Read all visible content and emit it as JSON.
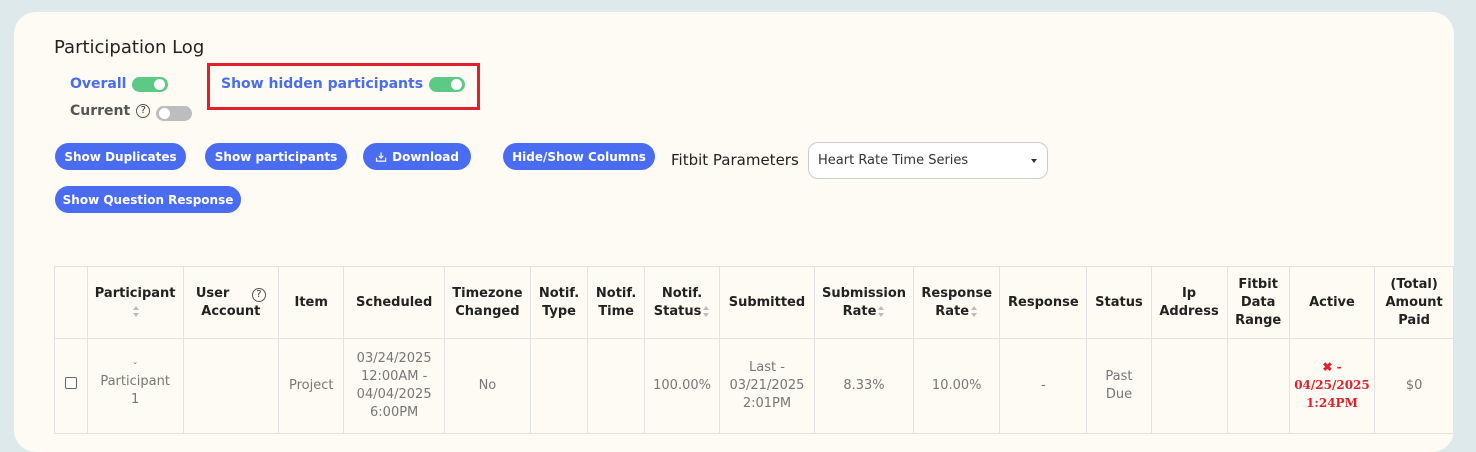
{
  "page_title": "Participation Log",
  "toggles": {
    "overall_label": "Overall",
    "overall_on": true,
    "current_label": "Current",
    "current_help": "?",
    "current_on": false,
    "hidden_label": "Show hidden participants",
    "hidden_on": true
  },
  "buttons": {
    "show_duplicates": "Show Duplicates",
    "show_participants": "Show participants",
    "download": "Download",
    "hide_show_columns": "Hide/Show Columns",
    "show_question_response": "Show Question Response"
  },
  "fitbit": {
    "label": "Fitbit Parameters",
    "selected": "Heart Rate Time Series"
  },
  "table": {
    "headers": {
      "participant": "Participant",
      "user_account_1": "User",
      "user_account_2": "Account",
      "user_account_help": "?",
      "item": "Item",
      "scheduled": "Scheduled",
      "timezone_1": "Timezone",
      "timezone_2": "Changed",
      "notif_type_1": "Notif.",
      "notif_type_2": "Type",
      "notif_time_1": "Notif.",
      "notif_time_2": "Time",
      "notif_status_1": "Notif.",
      "notif_status_2": "Status",
      "submitted": "Submitted",
      "submission_rate_1": "Submission",
      "submission_rate_2": "Rate",
      "response_rate_1": "Response",
      "response_rate_2": "Rate",
      "response": "Response",
      "status": "Status",
      "ip_1": "Ip",
      "ip_2": "Address",
      "fitbit_1": "Fitbit",
      "fitbit_2": "Data",
      "fitbit_3": "Range",
      "active": "Active",
      "amount_1": "(Total)",
      "amount_2": "Amount",
      "amount_3": "Paid"
    },
    "rows": [
      {
        "chevron": "ˇ",
        "participant_1": "Participant",
        "participant_2": "1",
        "user_account": "",
        "item": "Project",
        "scheduled_1": "03/24/2025",
        "scheduled_2": "12:00AM -",
        "scheduled_3": "04/04/2025",
        "scheduled_4": "6:00PM",
        "timezone_changed": "No",
        "notif_type": "",
        "notif_time": "",
        "notif_status": "100.00%",
        "submitted_1": "Last -",
        "submitted_2": "03/21/2025",
        "submitted_3": "2:01PM",
        "submission_rate": "8.33%",
        "response_rate": "10.00%",
        "response": "-",
        "status_1": "Past",
        "status_2": "Due",
        "ip_address": "",
        "fitbit_range": "",
        "active_mark": "✖ -",
        "active_1": "04/25/2025",
        "active_2": "1:24PM",
        "amount_paid": "$0"
      }
    ]
  },
  "colors": {
    "accent": "#4a6cf0",
    "toggle_on": "#5cc985",
    "highlight": "#e0202a"
  }
}
